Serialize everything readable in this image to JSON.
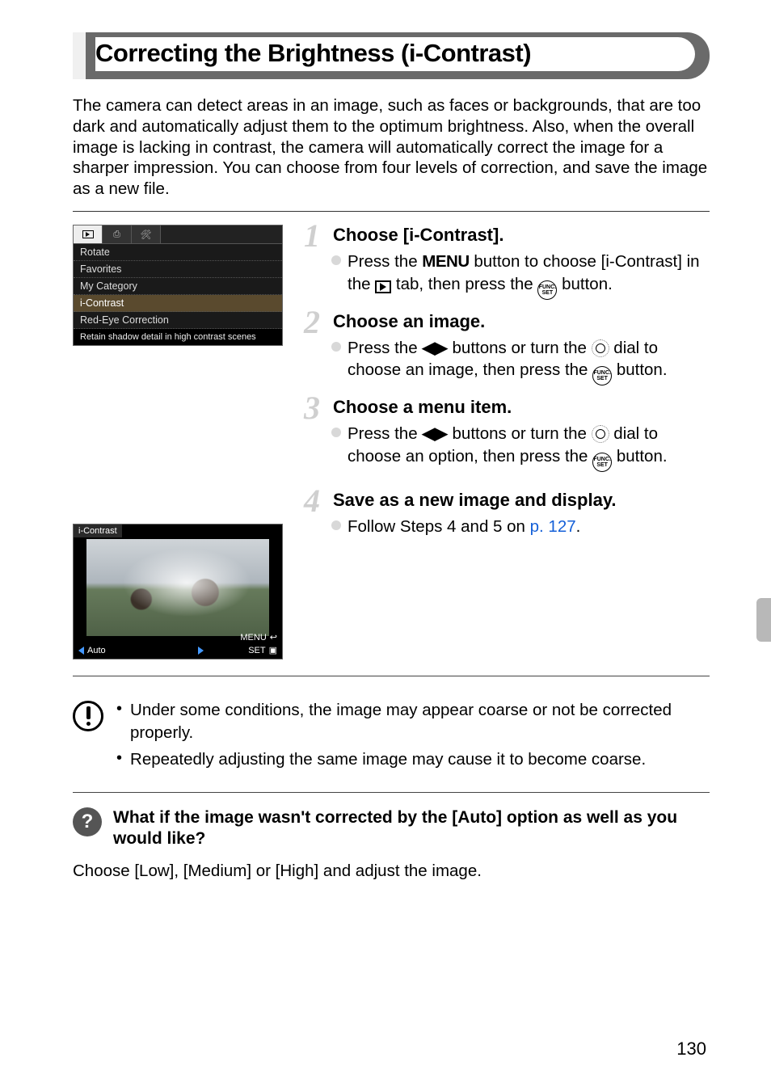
{
  "title": "Correcting the Brightness (i-Contrast)",
  "intro": "The camera can detect areas in an image, such as faces or backgrounds, that are too dark and automatically adjust them to the optimum brightness. Also, when the overall image is lacking in contrast, the camera will automatically correct the image for a sharper impression. You can choose from four levels of correction, and save the image as a new file.",
  "menu_shot": {
    "tabs": [
      {
        "id": "playback",
        "active": true
      },
      {
        "id": "print",
        "active": false
      },
      {
        "id": "tools",
        "active": false
      }
    ],
    "items": [
      {
        "label": "Rotate",
        "highlight": false
      },
      {
        "label": "Favorites",
        "highlight": false
      },
      {
        "label": "My Category",
        "highlight": false
      },
      {
        "label": "i-Contrast",
        "highlight": true
      },
      {
        "label": "Red-Eye Correction",
        "highlight": false
      }
    ],
    "footer": "Retain shadow detail in high contrast scenes"
  },
  "preview_shot": {
    "label": "i-Contrast",
    "mode": "Auto",
    "menu_btn": "MENU",
    "set_btn": "SET"
  },
  "steps": [
    {
      "num": "1",
      "title": "Choose [i-Contrast].",
      "body_parts": {
        "p1": "Press the ",
        "menu_word": "MENU",
        "p2": " button to choose [i-Contrast] in the ",
        "p3": " tab, then press the ",
        "p4": " button."
      }
    },
    {
      "num": "2",
      "title": "Choose an image.",
      "body_parts": {
        "p1": "Press the ",
        "p2": " buttons or turn the ",
        "p3": " dial to choose an image, then press the ",
        "p4": " button."
      }
    },
    {
      "num": "3",
      "title": "Choose a menu item.",
      "body_parts": {
        "p1": "Press the ",
        "p2": " buttons or turn the ",
        "p3": " dial to choose an option, then press the ",
        "p4": " button."
      }
    },
    {
      "num": "4",
      "title": "Save as a new image and display.",
      "body_parts": {
        "p1": "Follow Steps 4 and 5 on ",
        "link": "p. 127",
        "p2": "."
      }
    }
  ],
  "notes": [
    "Under some conditions, the image may appear coarse or not be corrected properly.",
    "Repeatedly adjusting the same image may cause it to become coarse."
  ],
  "question": {
    "title": "What if the image wasn't corrected by the [Auto] option as well as you would like?",
    "answer": "Choose [Low], [Medium] or [High] and adjust the image."
  },
  "page_number": "130",
  "func_label_top": "FUNC.",
  "func_label_bottom": "SET"
}
